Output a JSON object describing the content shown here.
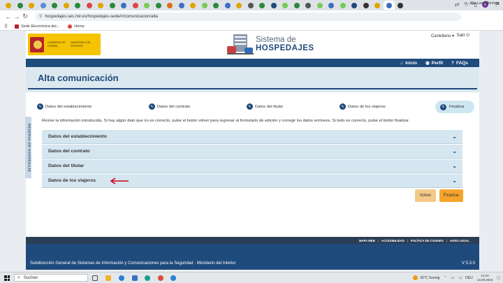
{
  "browser": {
    "url": "hospedajes.ses.mir.es/hospedajes-sede/#/comunicacion/alta",
    "window_controls": [
      "—",
      "❐",
      "✕"
    ],
    "bookmarks": [
      {
        "label": "Sede Electrónica del..."
      },
      {
        "label": "Home"
      }
    ],
    "reading_list": "Alle Lesezeichen",
    "profile_initial": "K",
    "tab_favicon_colors": [
      "#e0a600",
      "#2a8a3a",
      "#e0a600",
      "#5b8cd6",
      "#2a8a3a",
      "#e0a600",
      "#2a8a3a",
      "#d44",
      "#e0a600",
      "#2a8a3a",
      "#3a6fc4",
      "#d44",
      "#7c5",
      "#2a8a3a",
      "#e07010",
      "#3a6fc4",
      "#e0a600",
      "#7c5",
      "#2a8a3a",
      "#3a6fc4",
      "#e0a600",
      "#555",
      "#2a8a3a",
      "#1f4a7c",
      "#7c5",
      "#2a8a3a",
      "#555",
      "#7c5",
      "#3a6fc4",
      "#7c5",
      "#1f4a7c",
      "#333",
      "#e0a600",
      "#3a6fc4",
      "#333"
    ]
  },
  "header": {
    "gov_text_1": "GOBIERNO DE ESPAÑA",
    "gov_text_2": "MINISTERIO DEL INTERIOR",
    "app_title_line1": "Sistema de",
    "app_title_line2": "HOSPEDAJES",
    "language": "Castellano ▾",
    "logout": "Salir ⏻"
  },
  "nav": {
    "inicio": "Inicio",
    "perfil": "Perfil",
    "faqs": "FAQs"
  },
  "page_title": "Alta comunicación",
  "stepper": {
    "steps": [
      {
        "label": "Datos del establecimiento",
        "icon": "pencil-icon"
      },
      {
        "label": "Datos del contrato",
        "icon": "pencil-icon"
      },
      {
        "label": "Datos del titular",
        "icon": "pencil-icon"
      },
      {
        "label": "Datos de los viajeros",
        "icon": "pencil-icon"
      }
    ],
    "final": {
      "label": "Finalizar",
      "icon_text": "5"
    }
  },
  "instructions": "Revise la información introducida. Si hay algún dato que no es correcto, pulse el botón volver para regresar al formulario de edición y corregir los datos erróneos. Si todo es correcto, pulse el botón finalizar.",
  "accordion": [
    {
      "label": "Datos del establecimiento"
    },
    {
      "label": "Datos del contrato"
    },
    {
      "label": "Datos del titular"
    },
    {
      "label": "Datos de los viajeros"
    }
  ],
  "buttons": {
    "volver": "Volver",
    "finalizar": "Finalizar"
  },
  "side_tab": "RESERVA DE HOSPEDAJE",
  "footer": {
    "links": [
      "MAPA WEB",
      "ACCESIBILIDAD",
      "POLÍTICA DE COOKIES",
      "AVISO LEGAL"
    ],
    "org": "Subdirección General de Sistemas de Información y Comunicaciones para la Seguridad  ·  Ministerio del Interior",
    "version": "V 5.3.0"
  },
  "taskbar": {
    "search_placeholder": "Suchen",
    "weather": "30°C  Sonnig",
    "lang": "DEU",
    "time": "12:03",
    "date": "13.08.2023"
  },
  "colors": {
    "primary": "#1f4a7c",
    "accordion_bg": "#d6e6f0",
    "button_volver": "#f4c988",
    "button_finalizar": "#f5a52c",
    "arrow": "#d0021b"
  }
}
